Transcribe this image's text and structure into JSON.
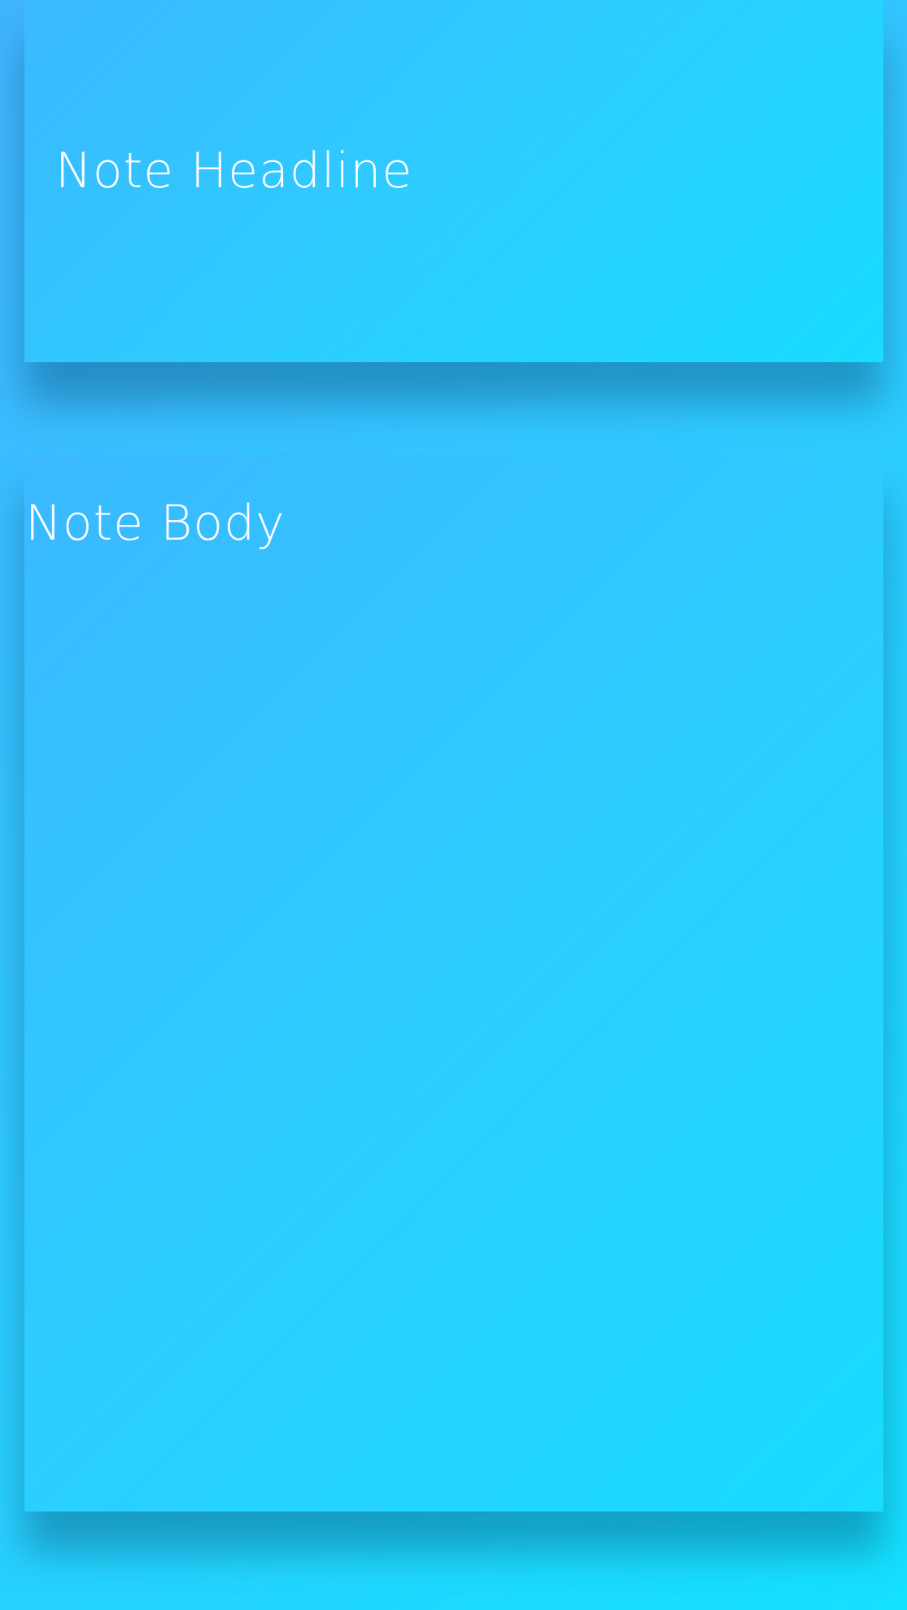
{
  "note": {
    "headline_placeholder": "Note Headline",
    "body_placeholder": "Note Body"
  },
  "colors": {
    "background_start": "#40b4ff",
    "background_end": "#14e2ff",
    "text": "#ffffff"
  }
}
